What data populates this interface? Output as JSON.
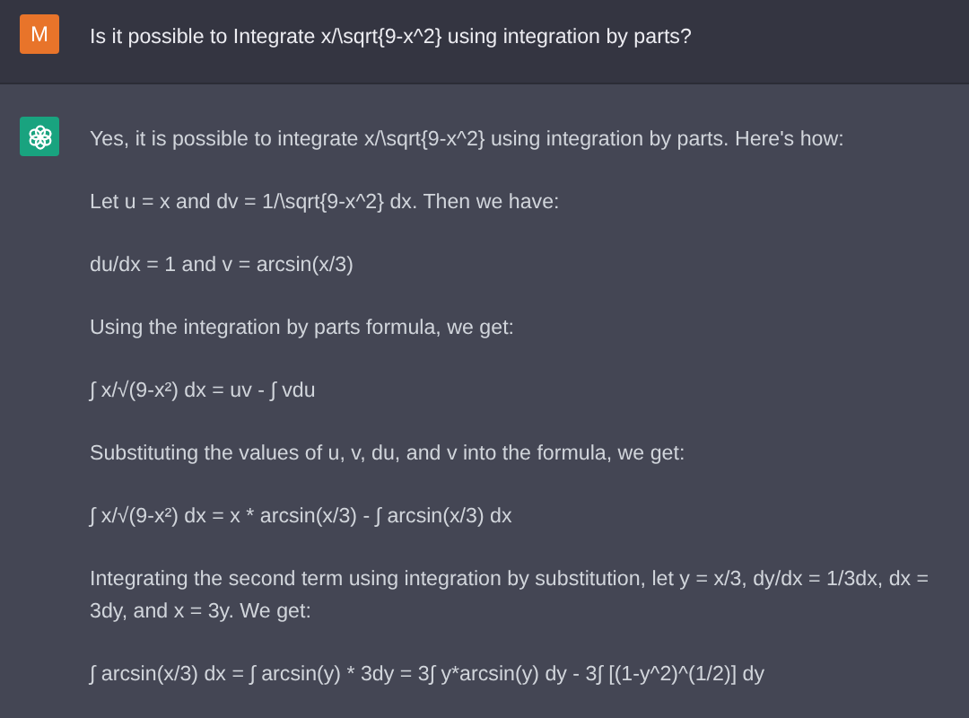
{
  "messages": [
    {
      "kind": "user",
      "avatar": "M",
      "paragraphs": [
        "Is it possible to Integrate x/\\sqrt{9-x^2} using integration by parts?"
      ]
    },
    {
      "kind": "assistant",
      "paragraphs": [
        "Yes, it is possible to integrate x/\\sqrt{9-x^2} using integration by parts. Here's how:",
        "Let u = x and dv = 1/\\sqrt{9-x^2} dx. Then we have:",
        "du/dx = 1 and v = arcsin(x/3)",
        "Using the integration by parts formula, we get:",
        "∫ x/√(9-x²) dx = uv - ∫ vdu",
        "Substituting the values of u, v, du, and v into the formula, we get:",
        "∫ x/√(9-x²) dx = x * arcsin(x/3) - ∫ arcsin(x/3) dx",
        "Integrating the second term using integration by substitution, let y = x/3, dy/dx = 1/3dx, dx = 3dy, and x = 3y. We get:",
        "∫ arcsin(x/3) dx = ∫ arcsin(y) * 3dy = 3∫ y*arcsin(y) dy - 3∫ [(1-y^2)^(1/2)] dy"
      ]
    }
  ]
}
